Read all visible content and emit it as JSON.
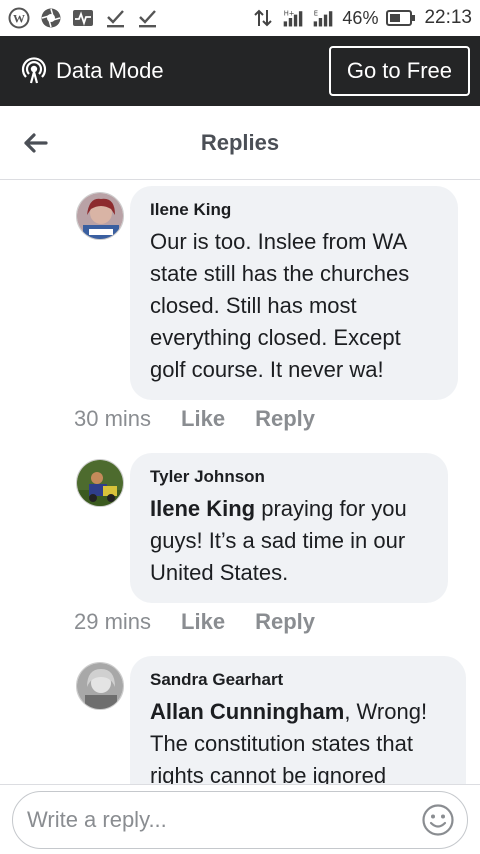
{
  "status_bar": {
    "battery": "46%",
    "time": "22:13"
  },
  "data_bar": {
    "mode_label": "Data Mode",
    "go_free_label": "Go to Free"
  },
  "header": {
    "title": "Replies"
  },
  "comments": [
    {
      "author": "Ilene King",
      "mention": "",
      "text": "Our is too.  Inslee from WA state still has the churches closed.  Still has most everything closed.  Except golf course. It never wa!",
      "time": "30 mins",
      "like": "Like",
      "reply": "Reply"
    },
    {
      "author": "Tyler Johnson",
      "mention": "Ilene King",
      "text": " praying for you guys! It’s a sad time in our United States.",
      "time": "29 mins",
      "like": "Like",
      "reply": "Reply"
    },
    {
      "author": "Sandra Gearhart",
      "mention": "Allan Cunningham",
      "text": ",  Wrong! The constitution states that rights cannot be ignored",
      "time": "",
      "like": "",
      "reply": ""
    }
  ],
  "reply_bar": {
    "placeholder": "Write a reply..."
  },
  "colors": {
    "data_bar_bg": "#242526",
    "bubble_bg": "#f0f2f5",
    "meta_text": "#8a8d91"
  }
}
